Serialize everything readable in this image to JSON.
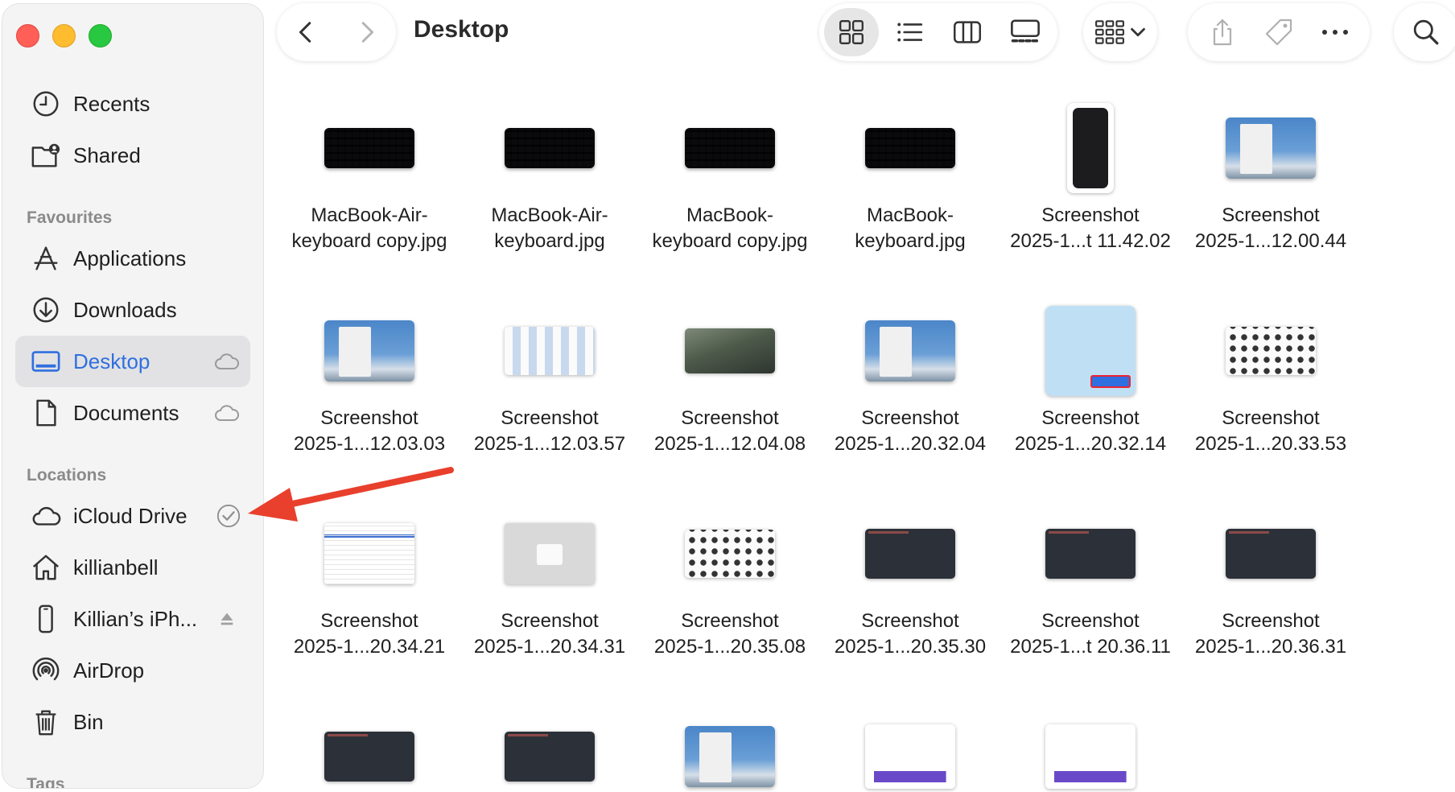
{
  "window": {
    "title": "Desktop"
  },
  "sidebar": {
    "top_items": [
      {
        "label": "Recents",
        "icon": "clock-icon"
      },
      {
        "label": "Shared",
        "icon": "shared-folder-icon"
      }
    ],
    "favourites_heading": "Favourites",
    "favourites": [
      {
        "label": "Applications",
        "icon": "applications-icon"
      },
      {
        "label": "Downloads",
        "icon": "download-icon"
      },
      {
        "label": "Desktop",
        "icon": "desktop-icon",
        "selected": true,
        "trailing": "cloud-icon"
      },
      {
        "label": "Documents",
        "icon": "document-icon",
        "trailing": "cloud-icon"
      }
    ],
    "locations_heading": "Locations",
    "locations": [
      {
        "label": "iCloud Drive",
        "icon": "cloud-icon",
        "trailing": "checkmark-circle-icon"
      },
      {
        "label": "killianbell",
        "icon": "home-icon"
      },
      {
        "label": "Killian’s iPh...",
        "icon": "iphone-icon",
        "trailing": "eject-icon"
      },
      {
        "label": "AirDrop",
        "icon": "airdrop-icon"
      },
      {
        "label": "Bin",
        "icon": "trash-icon"
      }
    ],
    "tags_heading": "Tags"
  },
  "toolbar": {
    "views": [
      "icon-view",
      "list-view",
      "column-view",
      "gallery-view"
    ],
    "selected_view": "icon-view"
  },
  "files": [
    {
      "line1": "MacBook-Air-",
      "line2": "keyboard copy.jpg",
      "thumb": "kb"
    },
    {
      "line1": "MacBook-Air-",
      "line2": "keyboard.jpg",
      "thumb": "kb"
    },
    {
      "line1": "MacBook-",
      "line2": "keyboard copy.jpg",
      "thumb": "kb"
    },
    {
      "line1": "MacBook-",
      "line2": "keyboard.jpg",
      "thumb": "kb"
    },
    {
      "line1": "Screenshot",
      "line2": "2025-1...t 11.42.02",
      "thumb": "phone"
    },
    {
      "line1": "Screenshot",
      "line2": "2025-1...12.00.44",
      "thumb": "blue"
    },
    {
      "line1": "Screenshot",
      "line2": "2025-1...12.03.03",
      "thumb": "blue"
    },
    {
      "line1": "Screenshot",
      "line2": "2025-1...12.03.57",
      "thumb": "white"
    },
    {
      "line1": "Screenshot",
      "line2": "2025-1...12.04.08",
      "thumb": "rock"
    },
    {
      "line1": "Screenshot",
      "line2": "2025-1...20.32.04",
      "thumb": "blue"
    },
    {
      "line1": "Screenshot",
      "line2": "2025-1...20.32.14",
      "thumb": "dlg"
    },
    {
      "line1": "Screenshot",
      "line2": "2025-1...20.33.53",
      "thumb": "white2"
    },
    {
      "line1": "Screenshot",
      "line2": "2025-1...20.34.21",
      "thumb": "sheet"
    },
    {
      "line1": "Screenshot",
      "line2": "2025-1...20.34.31",
      "thumb": "grey"
    },
    {
      "line1": "Screenshot",
      "line2": "2025-1...20.35.08",
      "thumb": "white2"
    },
    {
      "line1": "Screenshot",
      "line2": "2025-1...20.35.30",
      "thumb": "dark"
    },
    {
      "line1": "Screenshot",
      "line2": "2025-1...t 20.36.11",
      "thumb": "dark"
    },
    {
      "line1": "Screenshot",
      "line2": "2025-1...20.36.31",
      "thumb": "dark"
    },
    {
      "line1": "",
      "line2": "",
      "thumb": "dark"
    },
    {
      "line1": "",
      "line2": "",
      "thumb": "dark"
    },
    {
      "line1": "",
      "line2": "",
      "thumb": "blue"
    },
    {
      "line1": "",
      "line2": "",
      "thumb": "web"
    },
    {
      "line1": "",
      "line2": "",
      "thumb": "web"
    }
  ],
  "colors": {
    "accent": "#2f6fe0",
    "annotation_arrow": "#e8402d"
  }
}
